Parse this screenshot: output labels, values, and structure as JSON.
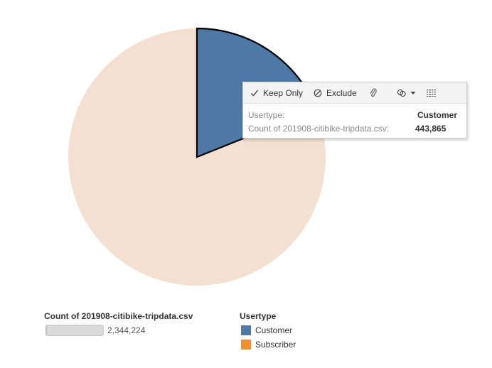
{
  "chart_data": {
    "type": "pie",
    "title": "",
    "slices": [
      {
        "label": "Customer",
        "value": 443865,
        "color": "#4e79a7"
      },
      {
        "label": "Subscriber",
        "value": 1900359,
        "color": "#f28e2b",
        "display_color": "#f3e0d0",
        "faded": true
      }
    ],
    "selected": "Customer"
  },
  "tooltip": {
    "actions": {
      "keep_only": "Keep Only",
      "exclude": "Exclude"
    },
    "field_label": "Usertype:",
    "field_value": "Customer",
    "measure_label": "Count of 201908-citibike-tripdata.csv:",
    "measure_value": "443,865"
  },
  "size_legend": {
    "title": "Count of 201908-citibike-tripdata.csv",
    "value": "2,344,224"
  },
  "color_legend": {
    "title": "Usertype",
    "items": [
      {
        "label": "Customer",
        "color": "#4e79a7"
      },
      {
        "label": "Subscriber",
        "color": "#f28e2b"
      }
    ]
  }
}
